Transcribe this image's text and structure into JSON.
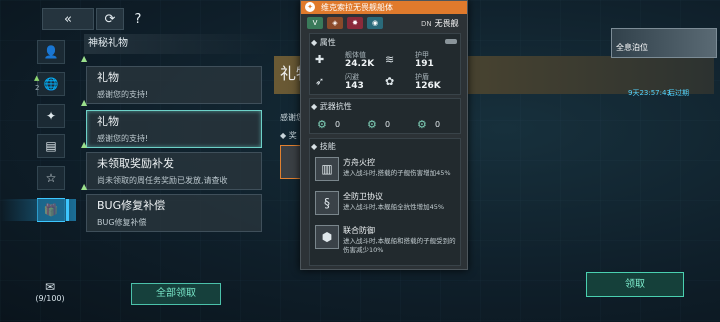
{
  "topbar": {
    "back_icon": "double-chevron-left-icon",
    "refresh_icon": "refresh-icon",
    "help_label": "?"
  },
  "sidebar": {
    "items": [
      {
        "icon": "person-icon",
        "glyph": "👤",
        "badge": ""
      },
      {
        "icon": "globe-icon",
        "glyph": "🌐",
        "badge": "2"
      },
      {
        "icon": "bolt-icon",
        "glyph": "✦",
        "badge": ""
      },
      {
        "icon": "document-icon",
        "glyph": "▤",
        "badge": ""
      },
      {
        "icon": "star-icon",
        "glyph": "☆",
        "badge": ""
      },
      {
        "icon": "gift-icon",
        "glyph": "🎁",
        "badge": ""
      }
    ],
    "mail_icon": "mail-icon",
    "mail_count": "(9/100)"
  },
  "list": {
    "header": "神秘礼物",
    "items": [
      {
        "title": "礼物",
        "subtitle": "感谢您的支持!",
        "selected": false
      },
      {
        "title": "礼物",
        "subtitle": "感谢您的支持!",
        "selected": true
      },
      {
        "title": "未领取奖励补发",
        "subtitle": "尚未领取的周任务奖励已发放,请查收",
        "selected": false
      },
      {
        "title": "BUG修复补偿",
        "subtitle": "BUG修复补偿",
        "selected": false
      }
    ],
    "claim_all_label": "全部领取"
  },
  "detail": {
    "title": "礼物",
    "timer": "9天23:57:43",
    "expire_label": "后过期",
    "body": "感谢您",
    "reward_label": "奖",
    "ship_badge_label": "全息泊位",
    "claim_label": "领取"
  },
  "tooltip": {
    "title": "维克索拉无畏舰船体",
    "tags": [
      {
        "icon": "chevron-down-icon",
        "glyph": "V",
        "color": "#3a7a5a"
      },
      {
        "icon": "shield-icon",
        "glyph": "◈",
        "color": "#8a4a2a"
      },
      {
        "icon": "flame-icon",
        "glyph": "✸",
        "color": "#8a2a3a"
      },
      {
        "icon": "wave-icon",
        "glyph": "◉",
        "color": "#2a6a7a"
      }
    ],
    "ship_class_code": "DN",
    "ship_class": "无畏舰",
    "attributes_header": "属性",
    "stats": [
      {
        "label": "舰体值",
        "value": "24.2K",
        "icon": "hull-icon",
        "glyph": "✚"
      },
      {
        "label": "护甲",
        "value": "191",
        "icon": "armor-icon",
        "glyph": "≋"
      },
      {
        "label": "闪避",
        "value": "143",
        "icon": "evade-icon",
        "glyph": "➶"
      },
      {
        "label": "护盾",
        "value": "126K",
        "icon": "shield-icon",
        "glyph": "✿"
      }
    ],
    "resist_header": "武器抗性",
    "resists": [
      {
        "icon": "resist-kinetic-icon",
        "value": "0"
      },
      {
        "icon": "resist-energy-icon",
        "value": "0"
      },
      {
        "icon": "resist-explosive-icon",
        "value": "0"
      }
    ],
    "skills_header": "技能",
    "skills": [
      {
        "name": "方舟火控",
        "desc": "进入战斗时,搭载的子舰伤害增加45%",
        "icon": "fire-control-icon",
        "glyph": "▥"
      },
      {
        "name": "全防卫协议",
        "desc": "进入战斗时,本舰船全抗性增加45%",
        "icon": "defense-protocol-icon",
        "glyph": "§"
      },
      {
        "name": "联合防御",
        "desc": "进入战斗时,本舰船和搭载的子舰受到的伤害减少10%",
        "icon": "joint-defense-icon",
        "glyph": "⬢"
      }
    ]
  }
}
